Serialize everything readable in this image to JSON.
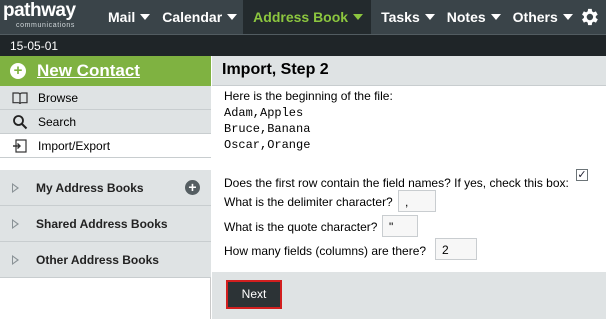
{
  "logo": {
    "word": "pathway",
    "sub": "communications"
  },
  "nav": {
    "items": [
      {
        "label": "Mail"
      },
      {
        "label": "Calendar"
      },
      {
        "label": "Address Book"
      },
      {
        "label": "Tasks"
      },
      {
        "label": "Notes"
      },
      {
        "label": "Others"
      }
    ],
    "active": "Address Book"
  },
  "date": "15-05-01",
  "sidebar": {
    "new_contact": "New Contact",
    "menu": [
      {
        "label": "Browse",
        "icon": "book-icon"
      },
      {
        "label": "Search",
        "icon": "search-icon"
      },
      {
        "label": "Import/Export",
        "icon": "import-export-icon"
      }
    ],
    "sections": [
      {
        "label": "My Address Books"
      },
      {
        "label": "Shared Address Books"
      },
      {
        "label": "Other Address Books"
      }
    ]
  },
  "main": {
    "title": "Import, Step 2",
    "intro": "Here is the beginning of the file:",
    "file_lines": [
      "Adam,Apples",
      "Bruce,Banana",
      "Oscar,Orange"
    ],
    "q_field_names": "Does the first row contain the field names? If yes, check this box:",
    "field_names_checked": true,
    "q_delimiter": "What is the delimiter character?",
    "delimiter_value": ",",
    "q_quote": "What is the quote character?",
    "quote_value": "\"",
    "q_fields": "How many fields (columns) are there?",
    "fields_value": "2",
    "next_label": "Next"
  },
  "colors": {
    "topbar": "#3a4449",
    "accent_green": "#8cc63f",
    "new_contact_green": "#7fb241",
    "highlight_red": "#d21f1f"
  }
}
